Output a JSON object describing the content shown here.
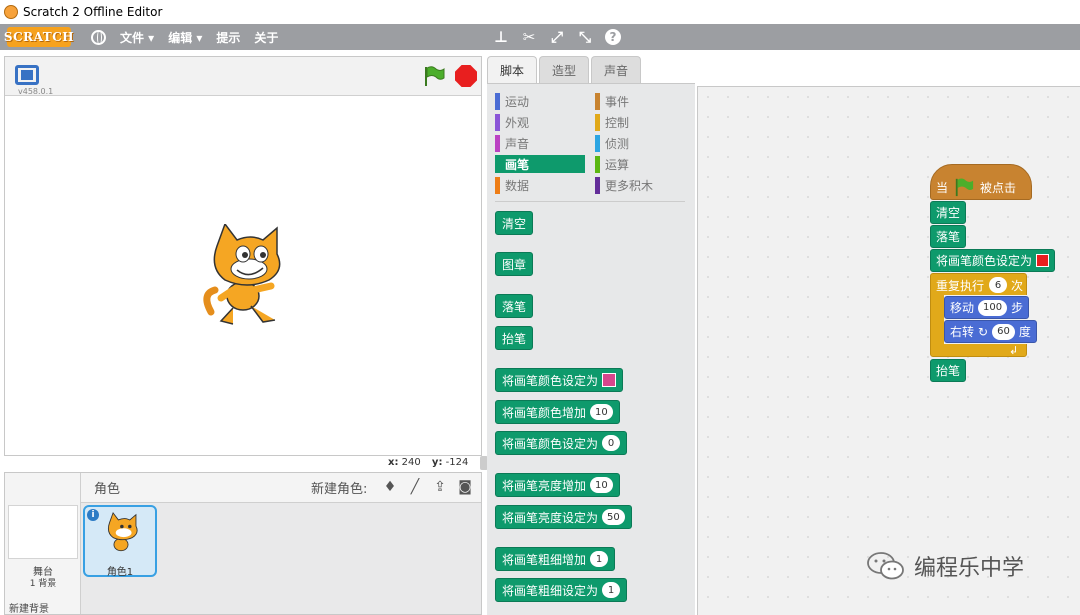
{
  "window": {
    "title": "Scratch 2 Offline Editor"
  },
  "menubar": {
    "logo": "SCRATCH",
    "items": [
      "文件 ▾",
      "编辑 ▾",
      "提示",
      "关于"
    ]
  },
  "stage": {
    "version": "v458.0.1",
    "coords": {
      "x_label": "x:",
      "x_value": "240",
      "y_label": "y:",
      "y_value": "-124"
    }
  },
  "sprites": {
    "header_label": "角色",
    "new_sprite_label": "新建角色:",
    "stage_label": "舞台",
    "stage_backdrops": "1 背景",
    "new_backdrop_label": "新建背景",
    "sprite_name": "角色1"
  },
  "tabs": [
    "脚本",
    "造型",
    "声音"
  ],
  "categories": [
    {
      "label": "运动",
      "color": "#4a6cd4"
    },
    {
      "label": "事件",
      "color": "#c88330"
    },
    {
      "label": "外观",
      "color": "#8a55d7"
    },
    {
      "label": "控制",
      "color": "#e1a91a"
    },
    {
      "label": "声音",
      "color": "#bb42c3"
    },
    {
      "label": "侦测",
      "color": "#2ca5e2"
    },
    {
      "label": "画笔",
      "color": "#0e9a6c"
    },
    {
      "label": "运算",
      "color": "#5cb712"
    },
    {
      "label": "数据",
      "color": "#ee7d16"
    },
    {
      "label": "更多积木",
      "color": "#632d99"
    }
  ],
  "palette_blocks": {
    "clear": "清空",
    "stamp": "图章",
    "pen_down": "落笔",
    "pen_up": "抬笔",
    "set_color": "将画笔颜色设定为",
    "change_color": "将画笔颜色增加",
    "change_color_val": "10",
    "set_color_num": "将画笔颜色设定为",
    "set_color_num_val": "0",
    "change_shade": "将画笔亮度增加",
    "change_shade_val": "10",
    "set_shade": "将画笔亮度设定为",
    "set_shade_val": "50",
    "change_size": "将画笔粗细增加",
    "change_size_val": "1",
    "set_size": "将画笔粗细设定为",
    "set_size_val": "1"
  },
  "script": {
    "hat_when": "当",
    "hat_clicked": "被点击",
    "clear": "清空",
    "pen_down": "落笔",
    "set_color": "将画笔颜色设定为",
    "repeat": "重复执行",
    "repeat_val": "6",
    "repeat_unit": "次",
    "move": "移动",
    "move_val": "100",
    "move_unit": "步",
    "turn": "右转",
    "turn_val": "60",
    "turn_unit": "度",
    "pen_up": "抬笔"
  },
  "watermark": "编程乐中学"
}
